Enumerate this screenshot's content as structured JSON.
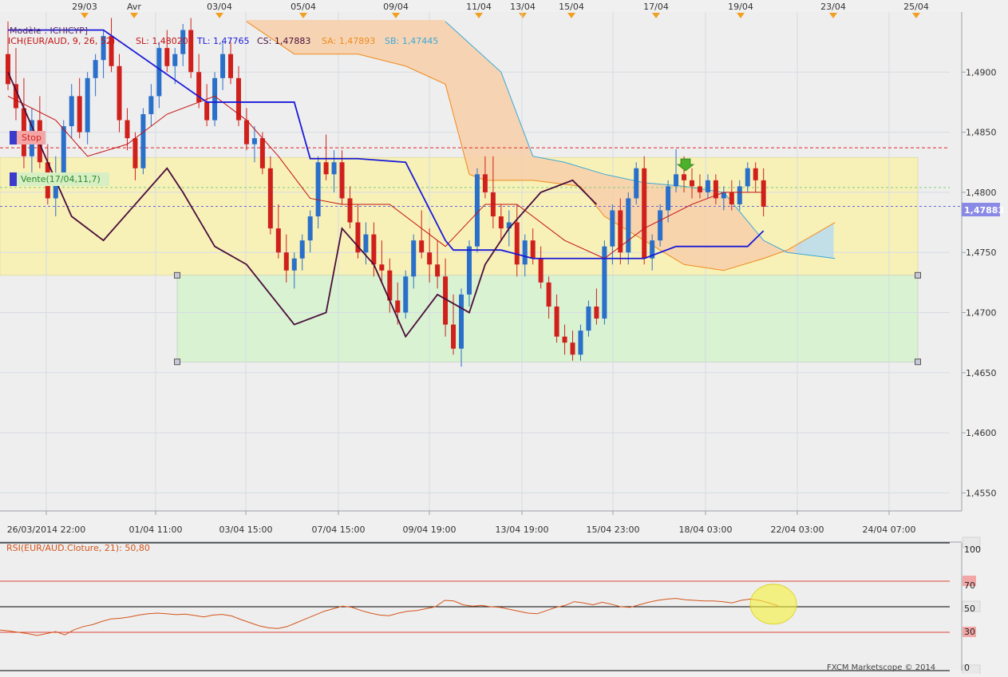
{
  "header": {
    "model_label": "Modèle : ICHICYP]",
    "indicator_prefix": "ICH(EUR/AUD, 9, 26, 52) -",
    "sl_label": "SL: 1,48020",
    "tl_label": "TL: 1,47765",
    "cs_label": "CS: 1,47883",
    "sa_label": "SA: 1,47893",
    "sb_label": "SB: 1,47445"
  },
  "price_tag": "1,47883",
  "stop_label": "Stop",
  "order_label": "Vente(17/04,11,7)",
  "rsi_header": "RSI(EUR/AUD.Cloture, 21): 50,80",
  "rsi_levels": [
    "100",
    "70",
    "50",
    "30",
    "0"
  ],
  "copyright": "FXCM Marketscope © 2014",
  "event_dates": [
    "29/03",
    "Avr",
    "03/04",
    "05/04",
    "09/04",
    "11/04",
    "13/04",
    "15/04",
    "17/04",
    "19/04",
    "23/04",
    "25/04"
  ],
  "colors": {
    "bull": "#2a6fc9",
    "bear": "#d0201c",
    "kijun": "#1a1ad8",
    "tenkan": "#c41212",
    "chikou": "#4a0c3a",
    "span_a": "#f08a1c",
    "span_b": "#3aa8d8",
    "cloud": "#f7cfa8",
    "cloud_blue": "#b9dcee",
    "band_yellow": "#f7f1b8",
    "band_green": "#d8f2d2",
    "rsi": "#d4541a"
  },
  "chart_data": [
    {
      "type": "candlestick",
      "title": "EUR/AUD",
      "y_ticks": [
        "1,4550",
        "1,4600",
        "1,4650",
        "1,4700",
        "1,4750",
        "1,4800",
        "1,4850",
        "1,4900"
      ],
      "x_ticks": [
        "26/03/2014 22:00",
        "01/04 11:00",
        "03/04 15:00",
        "07/04 15:00",
        "09/04 19:00",
        "13/04 19:00",
        "15/04 23:00",
        "18/04 03:00",
        "22/04 03:00",
        "24/04 07:00"
      ],
      "ylim": [
        1.4535,
        1.495
      ],
      "levels": {
        "stop": 1.4837,
        "order": 1.4804,
        "current": 1.47883,
        "zone_top": 1.4829,
        "zone_mid": 1.4731,
        "zone_bottom": 1.4659
      },
      "series": [
        {
          "name": "Candles",
          "ohlc": [
            [
              1.4915,
              1.4942,
              1.4885,
              1.489
            ],
            [
              1.489,
              1.492,
              1.486,
              1.487
            ],
            [
              1.487,
              1.4895,
              1.482,
              1.483
            ],
            [
              1.483,
              1.487,
              1.481,
              1.486
            ],
            [
              1.486,
              1.488,
              1.482,
              1.4825
            ],
            [
              1.4825,
              1.484,
              1.479,
              1.4795
            ],
            [
              1.4795,
              1.483,
              1.478,
              1.4815
            ],
            [
              1.4815,
              1.486,
              1.4805,
              1.4855
            ],
            [
              1.4855,
              1.489,
              1.4845,
              1.488
            ],
            [
              1.488,
              1.4895,
              1.4845,
              1.485
            ],
            [
              1.485,
              1.49,
              1.484,
              1.4895
            ],
            [
              1.4895,
              1.4915,
              1.488,
              1.491
            ],
            [
              1.491,
              1.4935,
              1.4895,
              1.493
            ],
            [
              1.493,
              1.4945,
              1.49,
              1.4905
            ],
            [
              1.4905,
              1.4915,
              1.485,
              1.486
            ],
            [
              1.486,
              1.487,
              1.4835,
              1.4845
            ],
            [
              1.4845,
              1.485,
              1.481,
              1.482
            ],
            [
              1.482,
              1.487,
              1.4815,
              1.4865
            ],
            [
              1.4865,
              1.489,
              1.4855,
              1.488
            ],
            [
              1.488,
              1.4925,
              1.487,
              1.492
            ],
            [
              1.492,
              1.4935,
              1.49,
              1.4905
            ],
            [
              1.4905,
              1.492,
              1.489,
              1.4915
            ],
            [
              1.4915,
              1.494,
              1.4905,
              1.4935
            ],
            [
              1.4935,
              1.4945,
              1.4895,
              1.49
            ],
            [
              1.49,
              1.4915,
              1.487,
              1.4875
            ],
            [
              1.4875,
              1.489,
              1.4855,
              1.486
            ],
            [
              1.486,
              1.49,
              1.4855,
              1.4895
            ],
            [
              1.4895,
              1.4925,
              1.4885,
              1.4915
            ],
            [
              1.4915,
              1.4925,
              1.489,
              1.4895
            ],
            [
              1.4895,
              1.4905,
              1.4855,
              1.486
            ],
            [
              1.486,
              1.487,
              1.4835,
              1.484
            ],
            [
              1.484,
              1.4855,
              1.4825,
              1.4845
            ],
            [
              1.4845,
              1.485,
              1.4815,
              1.482
            ],
            [
              1.482,
              1.483,
              1.4765,
              1.477
            ],
            [
              1.477,
              1.479,
              1.4745,
              1.475
            ],
            [
              1.475,
              1.4765,
              1.4725,
              1.4735
            ],
            [
              1.4735,
              1.475,
              1.472,
              1.4745
            ],
            [
              1.4745,
              1.4765,
              1.4735,
              1.476
            ],
            [
              1.476,
              1.4785,
              1.475,
              1.478
            ],
            [
              1.478,
              1.483,
              1.477,
              1.4825
            ],
            [
              1.4825,
              1.4848,
              1.481,
              1.4815
            ],
            [
              1.4815,
              1.4835,
              1.48,
              1.4825
            ],
            [
              1.4825,
              1.4835,
              1.479,
              1.4795
            ],
            [
              1.4795,
              1.4805,
              1.477,
              1.4775
            ],
            [
              1.4775,
              1.479,
              1.4745,
              1.475
            ],
            [
              1.475,
              1.4775,
              1.474,
              1.4765
            ],
            [
              1.4765,
              1.4775,
              1.473,
              1.474
            ],
            [
              1.474,
              1.476,
              1.4725,
              1.4735
            ],
            [
              1.4735,
              1.4745,
              1.47,
              1.471
            ],
            [
              1.471,
              1.4725,
              1.469,
              1.47
            ],
            [
              1.47,
              1.4735,
              1.4695,
              1.473
            ],
            [
              1.473,
              1.4765,
              1.472,
              1.476
            ],
            [
              1.476,
              1.4785,
              1.4745,
              1.475
            ],
            [
              1.475,
              1.477,
              1.4725,
              1.474
            ],
            [
              1.474,
              1.476,
              1.472,
              1.473
            ],
            [
              1.473,
              1.4745,
              1.468,
              1.469
            ],
            [
              1.469,
              1.4715,
              1.4665,
              1.467
            ],
            [
              1.467,
              1.472,
              1.4655,
              1.4715
            ],
            [
              1.4715,
              1.476,
              1.4705,
              1.4755
            ],
            [
              1.4755,
              1.482,
              1.475,
              1.4815
            ],
            [
              1.4815,
              1.483,
              1.4795,
              1.48
            ],
            [
              1.48,
              1.483,
              1.477,
              1.478
            ],
            [
              1.478,
              1.479,
              1.476,
              1.477
            ],
            [
              1.477,
              1.4785,
              1.4755,
              1.4775
            ],
            [
              1.4775,
              1.479,
              1.473,
              1.474
            ],
            [
              1.474,
              1.4765,
              1.473,
              1.476
            ],
            [
              1.476,
              1.477,
              1.474,
              1.4745
            ],
            [
              1.4745,
              1.4755,
              1.472,
              1.4725
            ],
            [
              1.4725,
              1.473,
              1.4695,
              1.4705
            ],
            [
              1.4705,
              1.4715,
              1.4675,
              1.468
            ],
            [
              1.468,
              1.469,
              1.4665,
              1.4675
            ],
            [
              1.4675,
              1.4685,
              1.466,
              1.4665
            ],
            [
              1.4665,
              1.469,
              1.466,
              1.4685
            ],
            [
              1.4685,
              1.471,
              1.468,
              1.4705
            ],
            [
              1.4705,
              1.472,
              1.469,
              1.4695
            ],
            [
              1.4695,
              1.476,
              1.469,
              1.4755
            ],
            [
              1.4755,
              1.479,
              1.474,
              1.4785
            ],
            [
              1.4785,
              1.4795,
              1.474,
              1.475
            ],
            [
              1.475,
              1.48,
              1.474,
              1.4795
            ],
            [
              1.4795,
              1.4825,
              1.479,
              1.482
            ],
            [
              1.482,
              1.483,
              1.474,
              1.4745
            ],
            [
              1.4745,
              1.4765,
              1.4735,
              1.476
            ],
            [
              1.476,
              1.479,
              1.4755,
              1.4785
            ],
            [
              1.4785,
              1.481,
              1.4775,
              1.4805
            ],
            [
              1.4805,
              1.4836,
              1.48,
              1.4815
            ],
            [
              1.4815,
              1.483,
              1.48,
              1.481
            ],
            [
              1.481,
              1.482,
              1.4795,
              1.4805
            ],
            [
              1.4805,
              1.4815,
              1.4795,
              1.48
            ],
            [
              1.48,
              1.4815,
              1.4795,
              1.481
            ],
            [
              1.481,
              1.4815,
              1.479,
              1.4795
            ],
            [
              1.4795,
              1.4805,
              1.4785,
              1.48
            ],
            [
              1.48,
              1.481,
              1.4785,
              1.479
            ],
            [
              1.479,
              1.481,
              1.4785,
              1.4805
            ],
            [
              1.4805,
              1.4825,
              1.48,
              1.482
            ],
            [
              1.482,
              1.4825,
              1.48,
              1.481
            ],
            [
              1.481,
              1.482,
              1.478,
              1.4788
            ]
          ]
        },
        {
          "name": "Kijun",
          "x": [
            0,
            5,
            12,
            25,
            30,
            36,
            38,
            44,
            50,
            55,
            56,
            60,
            62,
            66,
            75,
            80,
            84,
            88,
            93,
            95
          ],
          "y": [
            1.4935,
            1.4935,
            1.4935,
            1.4875,
            1.4875,
            1.4875,
            1.4828,
            1.4828,
            1.4825,
            1.476,
            1.4752,
            1.4752,
            1.4752,
            1.4745,
            1.4745,
            1.4745,
            1.4755,
            1.4755,
            1.4755,
            1.4768
          ]
        },
        {
          "name": "Tenkan",
          "x": [
            0,
            6,
            10,
            15,
            20,
            26,
            30,
            34,
            38,
            42,
            48,
            55,
            60,
            64,
            70,
            75,
            80,
            86,
            90,
            95
          ],
          "y": [
            1.488,
            1.486,
            1.483,
            1.484,
            1.4865,
            1.488,
            1.486,
            1.483,
            1.4795,
            1.479,
            1.479,
            1.4755,
            1.479,
            1.479,
            1.476,
            1.4745,
            1.477,
            1.479,
            1.48,
            1.48
          ]
        },
        {
          "name": "Chikou",
          "x": [
            0,
            4,
            8,
            12,
            16,
            20,
            22,
            26,
            30,
            33,
            36,
            40,
            42,
            46,
            50,
            54,
            58,
            60,
            63,
            67,
            71,
            74
          ],
          "y": [
            1.49,
            1.484,
            1.478,
            1.476,
            1.479,
            1.482,
            1.48,
            1.4755,
            1.474,
            1.4715,
            1.469,
            1.47,
            1.477,
            1.474,
            1.468,
            1.4715,
            1.47,
            1.474,
            1.477,
            1.48,
            1.481,
            1.479
          ]
        },
        {
          "name": "Span A",
          "x": [
            30,
            36,
            44,
            50,
            55,
            58,
            60,
            66,
            72,
            75,
            80,
            85,
            90,
            95,
            98,
            104
          ],
          "y": [
            1.4942,
            1.4915,
            1.4915,
            1.4905,
            1.489,
            1.4815,
            1.481,
            1.481,
            1.4805,
            1.478,
            1.476,
            1.474,
            1.4735,
            1.4745,
            1.4752,
            1.4775
          ]
        },
        {
          "name": "Span B",
          "x": [
            55,
            62,
            66,
            70,
            75,
            80,
            85,
            90,
            95,
            98,
            104
          ],
          "y": [
            1.4942,
            1.49,
            1.483,
            1.4825,
            1.4815,
            1.4808,
            1.4805,
            1.48,
            1.476,
            1.475,
            1.4745
          ]
        }
      ]
    },
    {
      "type": "line",
      "title": "RSI",
      "ylim": [
        0,
        100
      ],
      "series": [
        {
          "name": "RSI",
          "values": [
            31.8,
            31.0,
            30.0,
            29.0,
            27.5,
            29.0,
            30.5,
            28.0,
            32.0,
            34.5,
            36.0,
            38.5,
            40.5,
            41.0,
            42.0,
            43.5,
            44.5,
            45.0,
            44.5,
            43.8,
            44.2,
            43.2,
            42.0,
            43.5,
            44.0,
            42.8,
            40.0,
            37.5,
            35.0,
            33.5,
            33.0,
            34.5,
            37.5,
            40.5,
            43.5,
            46.5,
            48.5,
            50.5,
            49.5,
            47.0,
            45.0,
            43.5,
            43.0,
            45.0,
            46.5,
            47.0,
            48.5,
            50.0,
            55.0,
            54.5,
            51.5,
            50.5,
            51.0,
            50.0,
            49.5,
            48.0,
            46.5,
            45.0,
            44.5,
            47.0,
            49.5,
            51.0,
            54.0,
            53.0,
            51.5,
            53.5,
            52.0,
            50.0,
            49.5,
            51.5,
            53.5,
            55.0,
            56.0,
            56.5,
            55.5,
            55.0,
            54.5,
            54.5,
            54.0,
            53.0,
            55.0,
            56.0,
            55.0,
            53.0,
            50.8
          ]
        }
      ]
    }
  ]
}
